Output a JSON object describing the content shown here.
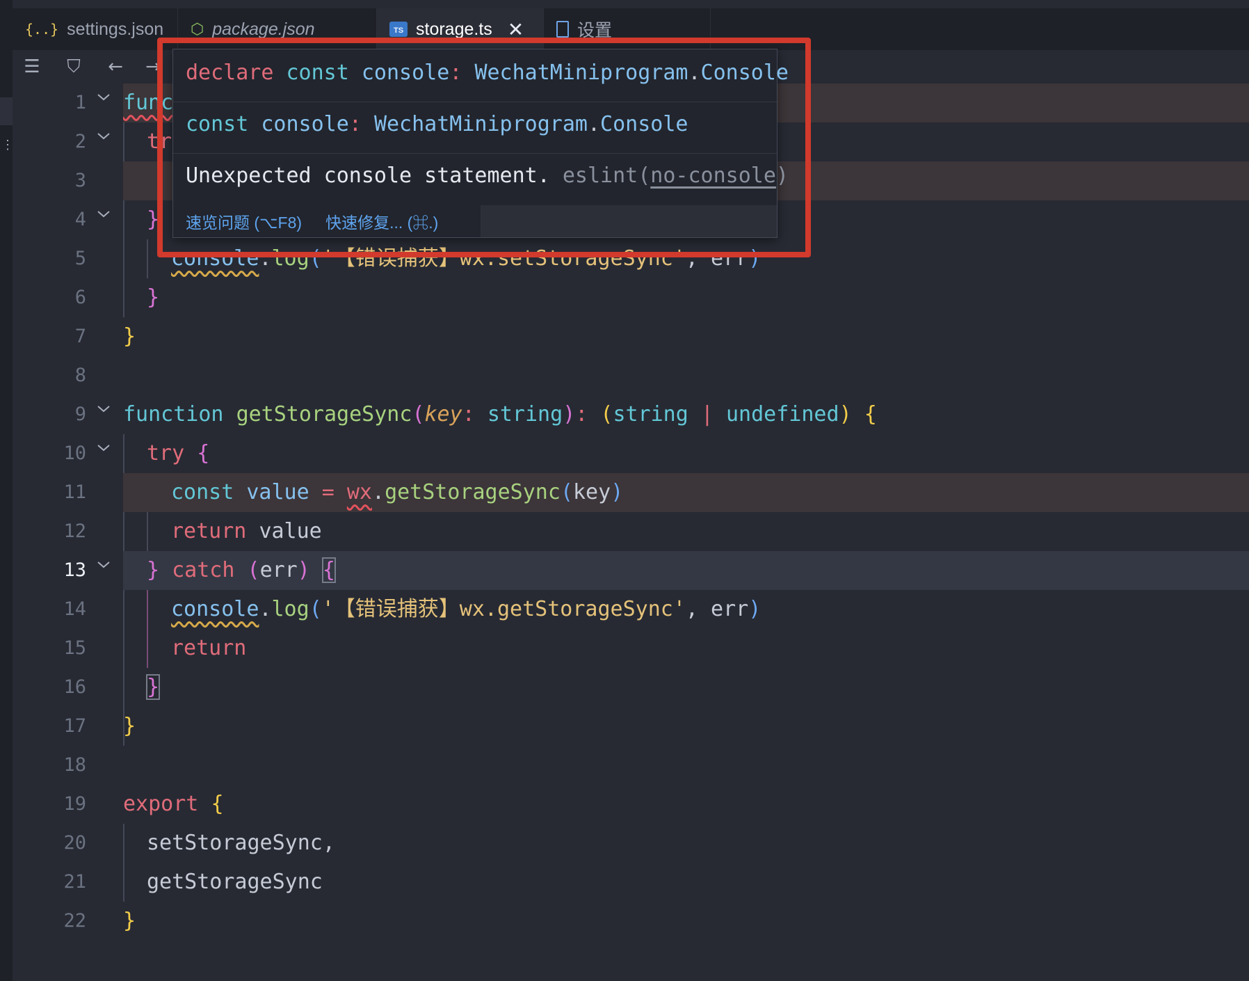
{
  "left_strip": {
    "more_glyph": "⋮"
  },
  "tabs": [
    {
      "label": "settings.json",
      "icon": "json-braces-icon",
      "icon_text": "{..}",
      "italic": false,
      "active": false
    },
    {
      "label": "package.json",
      "icon": "nodejs-icon",
      "icon_text": "⬡",
      "italic": true,
      "active": false
    },
    {
      "label": "storage.ts",
      "icon": "typescript-icon",
      "icon_text": "TS",
      "italic": false,
      "active": true,
      "close": "✕"
    },
    {
      "label": "设置",
      "icon": "file-icon",
      "icon_text": "",
      "italic": false,
      "active": false
    }
  ],
  "toolbar": {
    "outline_glyph": "☰",
    "bookmark_glyph": "⛉",
    "back_glyph": "←",
    "forward_glyph": "→"
  },
  "line_numbers": [
    "1",
    "2",
    "3",
    "4",
    "5",
    "6",
    "7",
    "8",
    "9",
    "10",
    "11",
    "12",
    "13",
    "14",
    "15",
    "16",
    "17",
    "18",
    "19",
    "20",
    "21",
    "22"
  ],
  "active_line": "13",
  "code": {
    "l1": {
      "a": "func",
      "b": "{"
    },
    "l2": {
      "a": "tr"
    },
    "l4": {
      "a": "}"
    },
    "l5": {
      "obj": "console",
      "dot": ".",
      "method": "log",
      "open": "(",
      "str": "'【错误捕获】wx.setStorageSync'",
      "rest": ", err",
      "close": ")"
    },
    "l6": {
      "a": "}"
    },
    "l7": {
      "a": "}"
    },
    "l9": {
      "kw": "function",
      "name": "getStorageSync",
      "p1": "(",
      "param": "key",
      "colon": ": ",
      "t1": "string",
      "p2": ")",
      "colon2": ": ",
      "p3": "(",
      "t2": "string",
      "bar": " | ",
      "t3": "undefined",
      "p4": ")",
      "brace": "{"
    },
    "l10": {
      "kw": "try",
      "brace": "{"
    },
    "l11": {
      "kw": "const",
      "v": "value",
      "eq": " = ",
      "obj": "wx",
      "dot": ".",
      "method": "getStorageSync",
      "p1": "(",
      "arg": "key",
      "p2": ")"
    },
    "l12": {
      "kw": "return",
      "v": "value"
    },
    "l13": {
      "b1": "}",
      "kw": "catch",
      "p1": "(",
      "arg": "err",
      "p2": ")",
      "b2": "{"
    },
    "l14": {
      "obj": "console",
      "dot": ".",
      "method": "log",
      "open": "(",
      "str": "'【错误捕获】wx.getStorageSync'",
      "rest": ", err",
      "close": ")"
    },
    "l15": {
      "kw": "return"
    },
    "l16": {
      "a": "}"
    },
    "l17": {
      "a": "}"
    },
    "l19": {
      "kw": "export",
      "brace": "{"
    },
    "l20": {
      "a": "setStorageSync,"
    },
    "l21": {
      "a": "getStorageSync"
    },
    "l22": {
      "a": "}"
    }
  },
  "hover": {
    "line1": {
      "declare": "declare",
      "const": "const",
      "name": "console",
      "colon": ":",
      "ns": "WechatMiniprogram",
      "dot": ".",
      "type": "Console"
    },
    "line2": {
      "const": "const",
      "name": "console",
      "colon": ":",
      "ns": "WechatMiniprogram",
      "dot": ".",
      "type": "Console"
    },
    "problem": {
      "message": "Unexpected console statement.",
      "source": "eslint(",
      "rule": "no-console",
      "close": ")"
    },
    "actions": {
      "peek": "速览问题 (⌥F8)",
      "quickfix": "快速修复... (⌘.)"
    }
  },
  "colors": {
    "annotation_red": "#d13a2c",
    "link_blue": "#5ea4ef",
    "warning_line_bg": "#3c3539"
  }
}
